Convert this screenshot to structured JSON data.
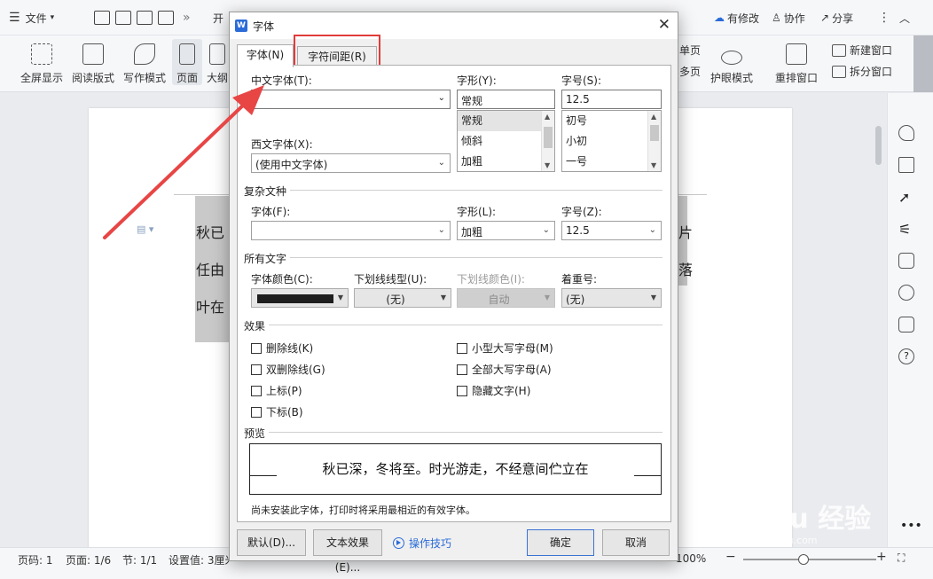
{
  "topbar": {
    "menu_label": "文件",
    "cut_label": "开",
    "status_right": [
      "有修改",
      "协作",
      "分享"
    ]
  },
  "ribbon": {
    "buttons": [
      "全屏显示",
      "阅读版式",
      "写作模式",
      "页面",
      "大纲"
    ],
    "right": {
      "eye": "护眼模式",
      "rearrange": "重排窗口",
      "new_window": "新建窗口",
      "split": "拆分窗口",
      "frag1": "单页",
      "frag2": "多页"
    }
  },
  "document": {
    "lines": [
      "秋已",
      "任由",
      "叶在"
    ],
    "right_frags": [
      "片",
      "落"
    ]
  },
  "status": {
    "items": [
      "页码: 1",
      "页面: 1/6",
      "节: 1/1",
      "设置值: 3厘米"
    ],
    "zoom": "100%"
  },
  "dialog": {
    "title": "字体",
    "logo": "W",
    "close": "✕",
    "tabs": {
      "font": "字体(N)",
      "spacing": "字符间距(R)"
    },
    "chinese_font_label": "中文字体(T):",
    "chinese_font_value": "",
    "western_font_label": "西文字体(X):",
    "western_font_value": "(使用中文字体)",
    "style_label": "字形(Y):",
    "style_value": "常规",
    "style_list": [
      "常规",
      "倾斜",
      "加粗"
    ],
    "size_label": "字号(S):",
    "size_value": "12.5",
    "size_list": [
      "初号",
      "小初",
      "一号"
    ],
    "complex_section": "复杂文种",
    "complex_font_label": "字体(F):",
    "complex_font_value": "",
    "complex_style_label": "字形(L):",
    "complex_style_value": "加粗",
    "complex_size_label": "字号(Z):",
    "complex_size_value": "12.5",
    "all_text_section": "所有文字",
    "color_label": "字体颜色(C):",
    "underline_label": "下划线线型(U):",
    "underline_value": "(无)",
    "underline_color_label": "下划线颜色(I):",
    "underline_color_value": "自动",
    "emphasis_label": "着重号:",
    "emphasis_value": "(无)",
    "effects_section": "效果",
    "effects_left": [
      "删除线(K)",
      "双删除线(G)",
      "上标(P)",
      "下标(B)"
    ],
    "effects_right": [
      "小型大写字母(M)",
      "全部大写字母(A)",
      "隐藏文字(H)"
    ],
    "preview_section": "预览",
    "preview_text": "秋已深，冬将至。时光游走，不经意间伫立在",
    "note": "尚未安装此字体，打印时将采用最相近的有效字体。",
    "buttons": {
      "default": "默认(D)...",
      "text_effects": "文本效果(E)...",
      "tips": "操作技巧",
      "ok": "确定",
      "cancel": "取消"
    }
  },
  "watermark": {
    "brand": "Bai du 经验",
    "url": "jingyan.baidu.com"
  },
  "colors": {
    "accent": "#2a6bd8",
    "highlight_box": "#e23b3b",
    "arrow": "#e84545"
  }
}
